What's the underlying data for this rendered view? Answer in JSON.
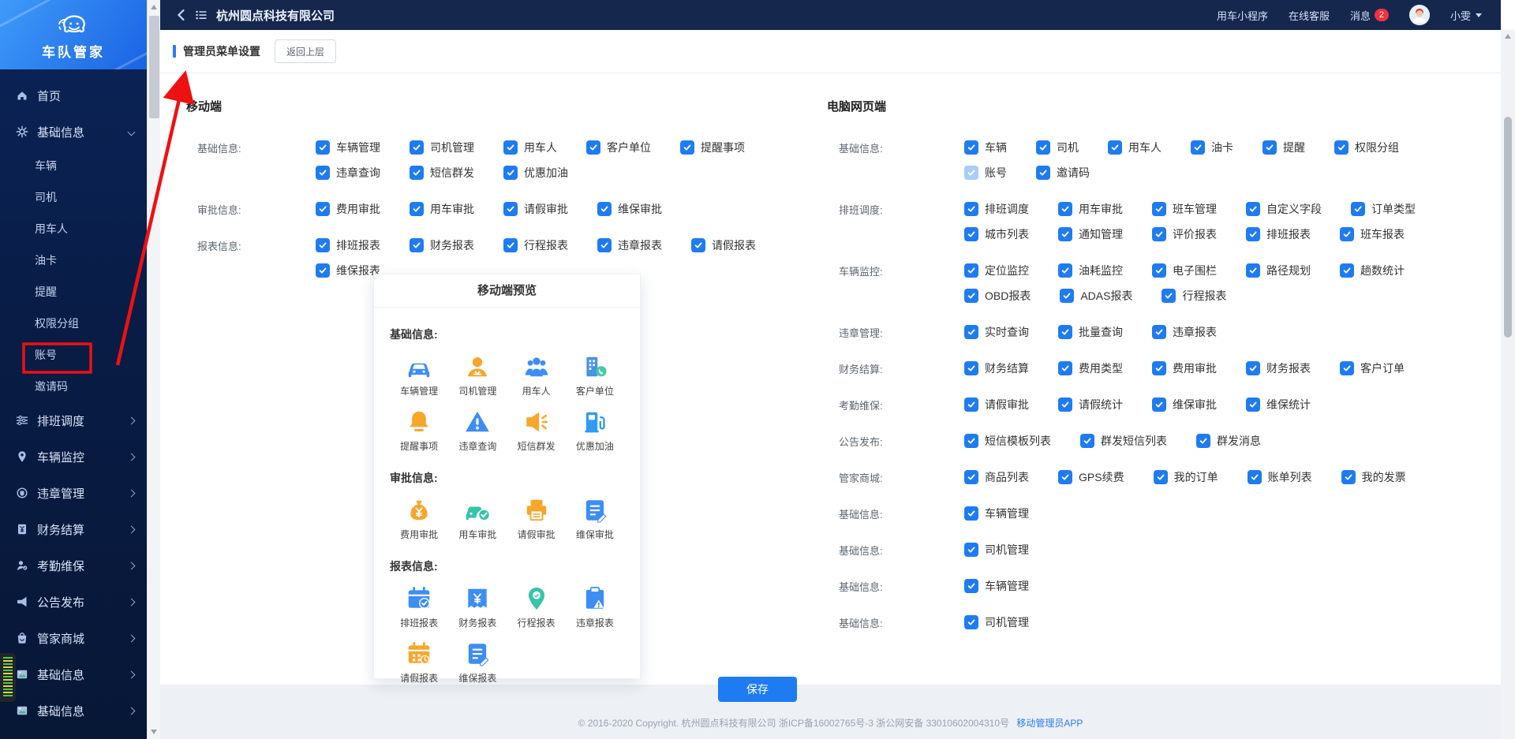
{
  "brand": {
    "name": "车队管家"
  },
  "topbar": {
    "company": "杭州圆点科技有限公司",
    "links": [
      "用车小程序",
      "在线客服"
    ],
    "messages_label": "消息",
    "messages_count": "2",
    "user": "小雯"
  },
  "page": {
    "title": "管理员菜单设置",
    "back_button": "返回上层",
    "save_button": "保存"
  },
  "sidebar": {
    "items": [
      {
        "key": "home",
        "label": "首页",
        "icon": "home",
        "type": "top"
      },
      {
        "key": "basic-info",
        "label": "基础信息",
        "icon": "gear",
        "type": "top",
        "chevron": "down"
      },
      {
        "key": "vehicle",
        "label": "车辆",
        "type": "sub"
      },
      {
        "key": "driver",
        "label": "司机",
        "type": "sub"
      },
      {
        "key": "passenger",
        "label": "用车人",
        "type": "sub"
      },
      {
        "key": "fuel-card",
        "label": "油卡",
        "type": "sub"
      },
      {
        "key": "reminder",
        "label": "提醒",
        "type": "sub"
      },
      {
        "key": "permission-group",
        "label": "权限分组",
        "type": "sub"
      },
      {
        "key": "account",
        "label": "账号",
        "type": "sub",
        "annotated": true
      },
      {
        "key": "invite-code",
        "label": "邀请码",
        "type": "sub"
      },
      {
        "key": "dispatch",
        "label": "排班调度",
        "icon": "sliders",
        "type": "top",
        "chevron": "right"
      },
      {
        "key": "vehicle-monitor",
        "label": "车辆监控",
        "icon": "pin",
        "type": "top",
        "chevron": "right"
      },
      {
        "key": "violation",
        "label": "违章管理",
        "icon": "badge",
        "type": "top",
        "chevron": "right"
      },
      {
        "key": "finance",
        "label": "财务结算",
        "icon": "money",
        "type": "top",
        "chevron": "right"
      },
      {
        "key": "attendance-maintenance",
        "label": "考勤维保",
        "icon": "person",
        "type": "top",
        "chevron": "right"
      },
      {
        "key": "announcement",
        "label": "公告发布",
        "icon": "megaphone",
        "type": "top",
        "chevron": "right"
      },
      {
        "key": "mall",
        "label": "管家商城",
        "icon": "bag",
        "type": "top",
        "chevron": "right"
      },
      {
        "key": "basic-info-2",
        "label": "基础信息",
        "icon": "image",
        "type": "top",
        "chevron": "right"
      },
      {
        "key": "basic-info-3",
        "label": "基础信息",
        "icon": "image",
        "type": "top",
        "chevron": "right"
      }
    ]
  },
  "mobile_panel": {
    "title": "移动端",
    "sections": [
      {
        "label": "基础信息:",
        "lines": [
          [
            "车辆管理",
            "司机管理",
            "用车人",
            "客户单位",
            "提醒事项"
          ],
          [
            "违章查询",
            "短信群发",
            "优惠加油"
          ]
        ]
      },
      {
        "label": "审批信息:",
        "lines": [
          [
            "费用审批",
            "用车审批",
            "请假审批",
            "维保审批"
          ]
        ]
      },
      {
        "label": "报表信息:",
        "lines": [
          [
            "排班报表",
            "财务报表",
            "行程报表",
            "违章报表",
            "请假报表"
          ],
          [
            "维保报表"
          ]
        ]
      }
    ]
  },
  "pc_panel": {
    "title": "电脑网页端",
    "sections": [
      {
        "label": "基础信息:",
        "lines": [
          [
            "车辆",
            "司机",
            "用车人",
            "油卡",
            "提醒",
            "权限分组"
          ],
          [
            {
              "label": "账号",
              "disabled": true
            },
            "邀请码"
          ]
        ]
      },
      {
        "label": "排班调度:",
        "lines": [
          [
            "排班调度",
            "用车审批",
            "班车管理",
            "自定义字段",
            "订单类型"
          ],
          [
            "城市列表",
            "通知管理",
            "评价报表",
            "排班报表",
            "班车报表"
          ]
        ]
      },
      {
        "label": "车辆监控:",
        "lines": [
          [
            "定位监控",
            "油耗监控",
            "电子围栏",
            "路径规划",
            "趟数统计"
          ],
          [
            "OBD报表",
            "ADAS报表",
            "行程报表"
          ]
        ]
      },
      {
        "label": "违章管理:",
        "lines": [
          [
            "实时查询",
            "批量查询",
            "违章报表"
          ]
        ]
      },
      {
        "label": "财务结算:",
        "lines": [
          [
            "财务结算",
            "费用类型",
            "费用审批",
            "财务报表",
            "客户订单"
          ]
        ]
      },
      {
        "label": "考勤维保:",
        "lines": [
          [
            "请假审批",
            "请假统计",
            "维保审批",
            "维保统计"
          ]
        ]
      },
      {
        "label": "公告发布:",
        "lines": [
          [
            "短信模板列表",
            "群发短信列表",
            "群发消息"
          ]
        ]
      },
      {
        "label": "管家商城:",
        "lines": [
          [
            "商品列表",
            "GPS续费",
            "我的订单",
            "账单列表",
            "我的发票"
          ]
        ]
      },
      {
        "label": "基础信息:",
        "lines": [
          [
            "车辆管理"
          ]
        ]
      },
      {
        "label": "基础信息:",
        "lines": [
          [
            "司机管理"
          ]
        ]
      },
      {
        "label": "基础信息:",
        "lines": [
          [
            "车辆管理"
          ]
        ]
      },
      {
        "label": "基础信息:",
        "lines": [
          [
            "司机管理"
          ]
        ]
      }
    ]
  },
  "preview": {
    "title": "移动端预览",
    "sections": [
      {
        "label": "基础信息:",
        "items": [
          {
            "label": "车辆管理",
            "icon": "car",
            "color": "#3d8df5"
          },
          {
            "label": "司机管理",
            "icon": "driver",
            "color": "#f7a62c"
          },
          {
            "label": "用车人",
            "icon": "people",
            "color": "#3d8df5"
          },
          {
            "label": "客户单位",
            "icon": "building",
            "color": "#4693e8"
          },
          {
            "label": "提醒事项",
            "icon": "bell",
            "color": "#f7a62c"
          },
          {
            "label": "违章查询",
            "icon": "warning",
            "color": "#3d8df5"
          },
          {
            "label": "短信群发",
            "icon": "megaphone",
            "color": "#f7a62c"
          },
          {
            "label": "优惠加油",
            "icon": "pump",
            "color": "#2f9bf2"
          }
        ]
      },
      {
        "label": "审批信息:",
        "items": [
          {
            "label": "费用审批",
            "icon": "moneybag",
            "color": "#f7a62c"
          },
          {
            "label": "用车审批",
            "icon": "carcheck",
            "color": "#38c4a8"
          },
          {
            "label": "请假审批",
            "icon": "printer",
            "color": "#f7a62c"
          },
          {
            "label": "维保审批",
            "icon": "note",
            "color": "#3d8df5"
          }
        ]
      },
      {
        "label": "报表信息:",
        "items": [
          {
            "label": "排班报表",
            "icon": "calcheck",
            "color": "#3d8df5"
          },
          {
            "label": "财务报表",
            "icon": "moneynote",
            "color": "#3d8df5"
          },
          {
            "label": "行程报表",
            "icon": "pinchart",
            "color": "#38c4a8"
          },
          {
            "label": "违章报表",
            "icon": "clipwarn",
            "color": "#3d8df5"
          },
          {
            "label": "请假报表",
            "icon": "calendar",
            "color": "#f7a62c"
          },
          {
            "label": "维保报表",
            "icon": "note",
            "color": "#3d8df5"
          }
        ]
      }
    ]
  },
  "footer": {
    "copyright": "© 2016-2020 Copyright. 杭州圆点科技有限公司 浙ICP备16002765号-3 浙公网安备 33010602004310号",
    "app_link": "移动管理员APP"
  },
  "colors": {
    "accent": "#1f7bf2",
    "checkbox_disabled": "#a9cdf6",
    "annotation_red": "#ee1111",
    "topbar": "#16274e",
    "sidebar": "#081c45"
  }
}
